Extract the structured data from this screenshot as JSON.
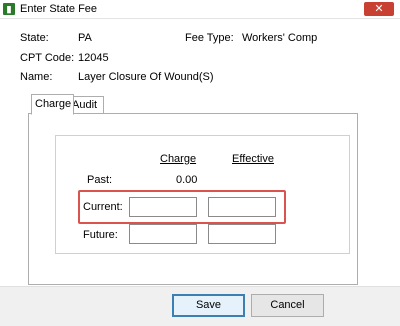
{
  "window": {
    "title": "Enter State Fee",
    "app_icon": "app-logo",
    "close_glyph": "✕"
  },
  "header": {
    "state_label": "State:",
    "state_value": "PA",
    "fee_type_label": "Fee Type:",
    "fee_type_value": "Workers' Comp",
    "cpt_label": "CPT Code:",
    "cpt_value": "12045",
    "name_label": "Name:",
    "name_value": "Layer Closure Of Wound(S)"
  },
  "tabs": [
    {
      "label": "Charge",
      "active": true
    },
    {
      "label": "Audit",
      "active": false
    }
  ],
  "grid": {
    "columns": [
      "Charge",
      "Effective"
    ],
    "rows": {
      "past_label": "Past:",
      "past_charge": "0.00",
      "current_label": "Current:",
      "current_charge": "",
      "current_effective": "",
      "future_label": "Future:",
      "future_charge": "",
      "future_effective": ""
    }
  },
  "buttons": {
    "save_label": "Save",
    "cancel_label": "Cancel"
  },
  "colors": {
    "highlight": "#d9534f",
    "close_button": "#c84031"
  }
}
